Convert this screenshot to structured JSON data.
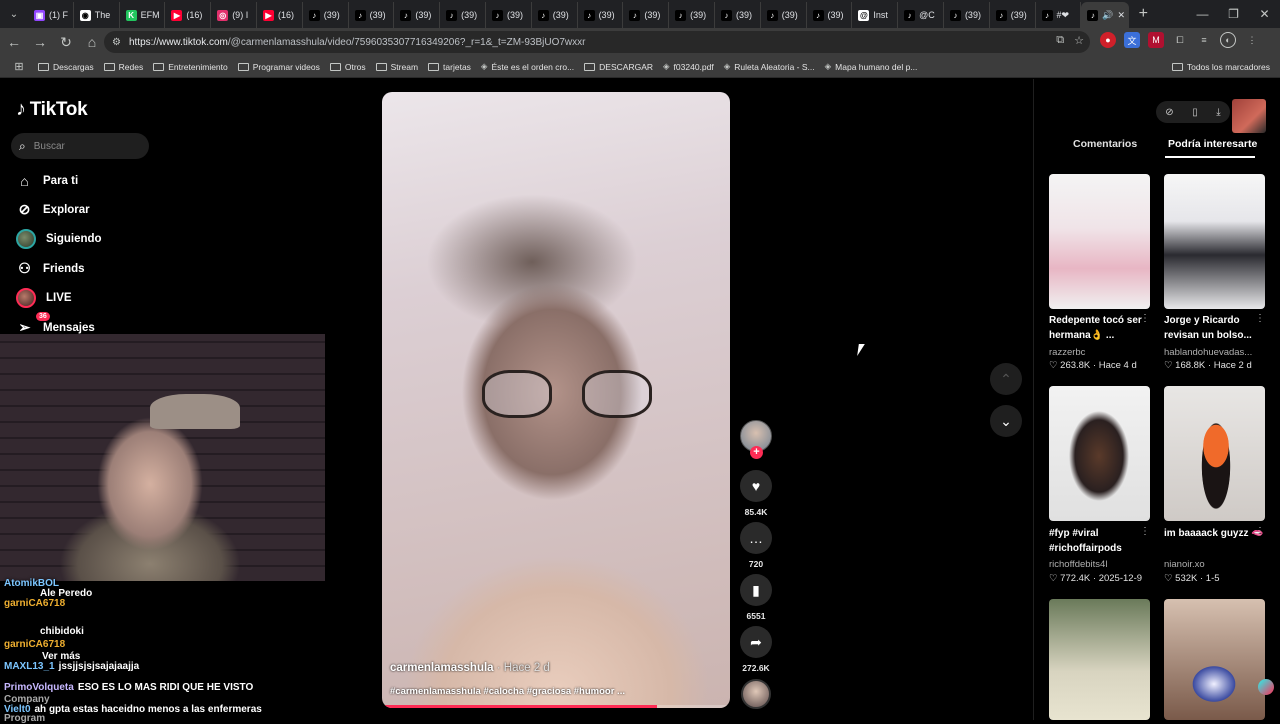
{
  "browser": {
    "tabs": [
      {
        "label": "(1) F",
        "color": "#9146ff",
        "glyph": "▣"
      },
      {
        "label": "The",
        "color": "#ffffff",
        "glyph": "◉"
      },
      {
        "label": "EFM",
        "color": "#22c55e",
        "glyph": "K"
      },
      {
        "label": "(16)",
        "color": "#ff0033",
        "glyph": "▶"
      },
      {
        "label": "(9) I",
        "color": "#e1306c",
        "glyph": "◎"
      },
      {
        "label": "(16)",
        "color": "#ff0033",
        "glyph": "▶"
      },
      {
        "label": "(39)",
        "color": "#000000",
        "glyph": "♪"
      },
      {
        "label": "(39)",
        "color": "#000000",
        "glyph": "♪"
      },
      {
        "label": "(39)",
        "color": "#000000",
        "glyph": "♪"
      },
      {
        "label": "(39)",
        "color": "#000000",
        "glyph": "♪"
      },
      {
        "label": "(39)",
        "color": "#000000",
        "glyph": "♪"
      },
      {
        "label": "(39)",
        "color": "#000000",
        "glyph": "♪"
      },
      {
        "label": "(39)",
        "color": "#000000",
        "glyph": "♪"
      },
      {
        "label": "(39)",
        "color": "#000000",
        "glyph": "♪"
      },
      {
        "label": "(39)",
        "color": "#000000",
        "glyph": "♪"
      },
      {
        "label": "(39)",
        "color": "#000000",
        "glyph": "♪"
      },
      {
        "label": "(39)",
        "color": "#000000",
        "glyph": "♪"
      },
      {
        "label": "(39)",
        "color": "#000000",
        "glyph": "♪"
      },
      {
        "label": "Inst",
        "color": "#ffffff",
        "glyph": "@"
      },
      {
        "label": "@C",
        "color": "#000000",
        "glyph": "♪"
      },
      {
        "label": "(39)",
        "color": "#000000",
        "glyph": "♪"
      },
      {
        "label": "(39)",
        "color": "#000000",
        "glyph": "♪"
      },
      {
        "label": "#❤",
        "color": "#000000",
        "glyph": "♪"
      }
    ],
    "url_host": "https://www.tiktok.com",
    "url_path": "/@carmenlamasshula/video/7596035307716349206?_r=1&_t=ZM-93BjUO7wxxr",
    "bookmarks": [
      {
        "label": "Descargas",
        "type": "folder"
      },
      {
        "label": "Redes",
        "type": "folder"
      },
      {
        "label": "Entretenimiento",
        "type": "folder"
      },
      {
        "label": "Programar videos",
        "type": "folder"
      },
      {
        "label": "Otros",
        "type": "folder"
      },
      {
        "label": "Stream",
        "type": "folder"
      },
      {
        "label": "tarjetas",
        "type": "folder"
      },
      {
        "label": "Éste es el orden cro...",
        "type": "link"
      },
      {
        "label": "DESCARGAR",
        "type": "folder"
      },
      {
        "label": "f03240.pdf",
        "type": "link"
      },
      {
        "label": "Ruleta Aleatoria - S...",
        "type": "link"
      },
      {
        "label": "Mapa humano del p...",
        "type": "link"
      }
    ],
    "all_bookmarks": "Todos los marcadores"
  },
  "tiktok": {
    "logo": "TikTok",
    "search_placeholder": "Buscar",
    "nav": {
      "for_you": "Para ti",
      "explore": "Explorar",
      "following": "Siguiendo",
      "friends": "Friends",
      "live": "LIVE",
      "messages": "Mensajes",
      "messages_badge": "36"
    },
    "video": {
      "username": "carmenlamasshula",
      "time": " · Hace 2 d",
      "description": "#carmenlamasshula #calocha #graciosa #humoor ...",
      "progress": 0.79
    },
    "actions": {
      "likes": "85.4K",
      "comments": "720",
      "saves": "6551",
      "shares": "272.6K"
    },
    "panel": {
      "tab_comments": "Comentarios",
      "tab_suggested": "Podría interesarte",
      "cards": [
        {
          "title": "Redepente tocó ser hermana👌 ...",
          "author": "razzerbc",
          "stats": "♡ 263.8K · Hace 4 d"
        },
        {
          "title": "Jorge y Ricardo revisan un bolso...",
          "author": "hablandohuevadas...",
          "stats": "♡ 168.8K · Hace 2 d"
        },
        {
          "title": "#fyp #viral #richoffairpods",
          "author": "richoffdebits4l",
          "stats": "♡ 772.4K · 2025-12-9"
        },
        {
          "title": "im baaaack guyzz 🫦",
          "author": "nianoir.xo",
          "stats": "♡ 532K · 1-5"
        }
      ]
    }
  },
  "stream_chat": [
    {
      "user": "AtomikBOL",
      "text": "",
      "color": "#7cc6ff"
    },
    {
      "user": "Ale Peredo",
      "text": "",
      "color": "#ffffff"
    },
    {
      "user": "garniCA6718",
      "text": "",
      "color": "#f0b030"
    },
    {
      "user": "chibidoki",
      "text": "",
      "color": "#ffffff"
    },
    {
      "user": "garniCA6718",
      "text": "",
      "color": "#f0b030"
    },
    {
      "user": "Ver más",
      "text": "",
      "color": "#ffffff"
    },
    {
      "user": "MAXL13_1",
      "text": "jssjjsjsjsajajaajja",
      "color": "#7cc6ff"
    },
    {
      "user": "PrimoVolqueta",
      "text": "ESO ES LO MAS RIDI QUE HE VISTO",
      "color": "#c7b8ff"
    },
    {
      "user": "Company",
      "text": "",
      "color": "#aaaaaa"
    },
    {
      "user": "Vielt0",
      "text": "ah gpta estas haceidno menos a las enfermeras",
      "color": "#7cc6ff"
    },
    {
      "user": "Program",
      "text": "",
      "color": "#aaaaaa"
    }
  ]
}
